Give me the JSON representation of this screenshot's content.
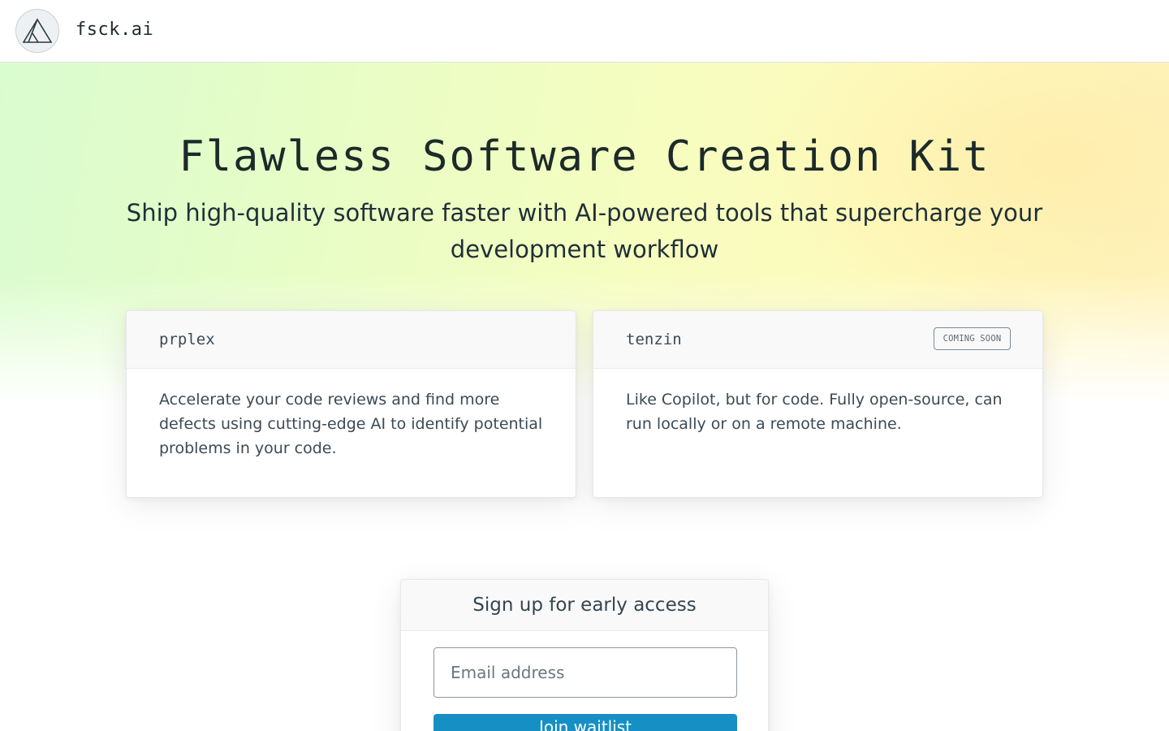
{
  "header": {
    "brand": "fsck.ai",
    "logo_icon": "mountain-triangle-icon"
  },
  "hero": {
    "title": "Flawless Software Creation Kit",
    "subtitle": "Ship high-quality software faster with AI-powered tools that supercharge your development workflow"
  },
  "products": [
    {
      "name": "prplex",
      "description": "Accelerate your code reviews and find more defects using cutting-edge AI to identify potential problems in your code."
    },
    {
      "name": "tenzin",
      "badge": "COMING SOON",
      "description": "Like Copilot, but for code. Fully open-source, can run locally or on a remote machine."
    }
  ],
  "signup": {
    "title": "Sign up for early access",
    "email_placeholder": "Email address",
    "button_label": "Join waitlist"
  },
  "colors": {
    "accent": "#1690c4",
    "text_dark": "#1f2a30",
    "hero_green": "#d9fccf",
    "hero_yellow": "#fdfbbd"
  }
}
